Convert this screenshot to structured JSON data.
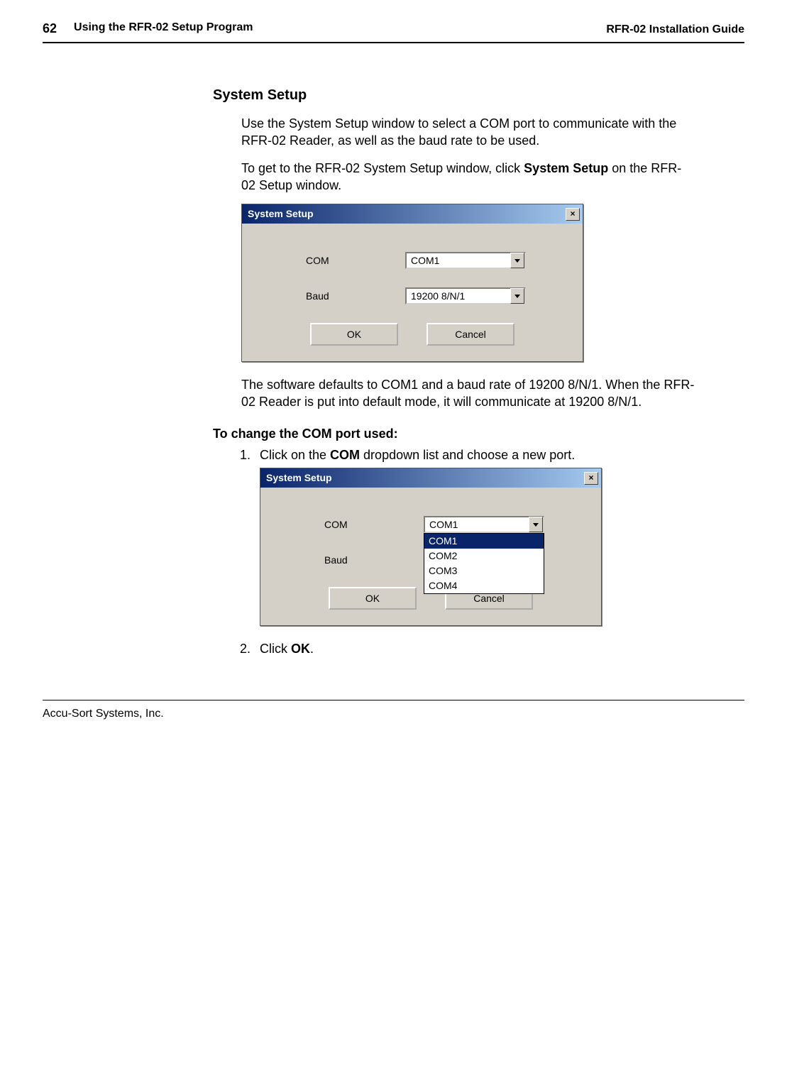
{
  "header": {
    "page_number": "62",
    "section": "Using the RFR-02 Setup Program",
    "guide": "RFR-02 Installation Guide"
  },
  "section_title": "System Setup",
  "intro_para": "Use the System Setup window to select a COM port to communicate with the RFR-02 Reader, as well as the baud rate to be used.",
  "nav_para_pre": "To get to the RFR-02 System Setup window, click ",
  "nav_para_bold": "System Setup",
  "nav_para_post": " on the RFR-02 Setup window.",
  "dialog1": {
    "title": "System Setup",
    "close": "×",
    "com_label": "COM",
    "com_value": "COM1",
    "baud_label": "Baud",
    "baud_value": "19200 8/N/1",
    "ok": "OK",
    "cancel": "Cancel"
  },
  "defaults_para": "The software defaults to COM1 and a baud rate of 19200 8/N/1. When the RFR-02 Reader is put into default mode, it will communicate at 19200 8/N/1.",
  "change_heading": "To change the COM port used:",
  "step1_pre": "Click on the ",
  "step1_bold": "COM",
  "step1_post": " dropdown list and choose a new port.",
  "dialog2": {
    "title": "System Setup",
    "close": "×",
    "com_label": "COM",
    "com_value": "COM1",
    "baud_label": "Baud",
    "options": [
      "COM1",
      "COM2",
      "COM3",
      "COM4"
    ],
    "ok": "OK",
    "cancel": "Cancel"
  },
  "step2_pre": "Click ",
  "step2_bold": "OK",
  "step2_post": ".",
  "footer": "Accu-Sort Systems, Inc."
}
